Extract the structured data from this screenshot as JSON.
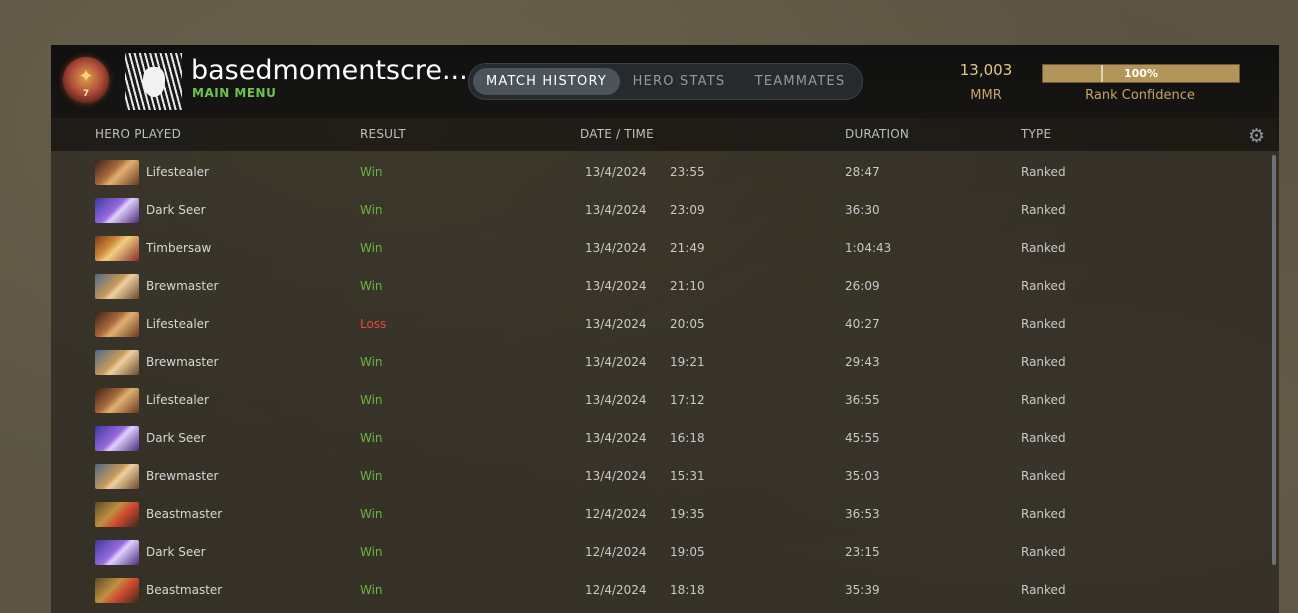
{
  "profile": {
    "username": "basedmomentscre...",
    "main_menu": "MAIN MENU",
    "rank_medal_number": "7"
  },
  "tabs": [
    {
      "label": "MATCH HISTORY",
      "active": true
    },
    {
      "label": "HERO STATS",
      "active": false
    },
    {
      "label": "TEAMMATES",
      "active": false
    }
  ],
  "stats": {
    "mmr_value": "13,003",
    "mmr_label": "MMR",
    "rank_confidence_pct": "100%",
    "rank_confidence_fraction": 1.0,
    "rank_confidence_label": "Rank Confidence"
  },
  "columns": {
    "hero": "HERO PLAYED",
    "result": "RESULT",
    "datetime": "DATE / TIME",
    "duration": "DURATION",
    "type": "TYPE"
  },
  "colors": {
    "win": "#6cb43f",
    "loss": "#e04a3a",
    "accent_green": "#6fc24d",
    "gold": "#b39559"
  },
  "matches": [
    {
      "hero": "Lifestealer",
      "hero_icon": "lifestealer-portrait",
      "result": "Win",
      "date": "13/4/2024",
      "time": "23:55",
      "duration": "28:47",
      "type": "Ranked"
    },
    {
      "hero": "Dark Seer",
      "hero_icon": "dark-seer-portrait",
      "result": "Win",
      "date": "13/4/2024",
      "time": "23:09",
      "duration": "36:30",
      "type": "Ranked"
    },
    {
      "hero": "Timbersaw",
      "hero_icon": "timbersaw-portrait",
      "result": "Win",
      "date": "13/4/2024",
      "time": "21:49",
      "duration": "1:04:43",
      "type": "Ranked"
    },
    {
      "hero": "Brewmaster",
      "hero_icon": "brewmaster-portrait",
      "result": "Win",
      "date": "13/4/2024",
      "time": "21:10",
      "duration": "26:09",
      "type": "Ranked"
    },
    {
      "hero": "Lifestealer",
      "hero_icon": "lifestealer-portrait",
      "result": "Loss",
      "date": "13/4/2024",
      "time": "20:05",
      "duration": "40:27",
      "type": "Ranked"
    },
    {
      "hero": "Brewmaster",
      "hero_icon": "brewmaster-portrait",
      "result": "Win",
      "date": "13/4/2024",
      "time": "19:21",
      "duration": "29:43",
      "type": "Ranked"
    },
    {
      "hero": "Lifestealer",
      "hero_icon": "lifestealer-portrait",
      "result": "Win",
      "date": "13/4/2024",
      "time": "17:12",
      "duration": "36:55",
      "type": "Ranked"
    },
    {
      "hero": "Dark Seer",
      "hero_icon": "dark-seer-portrait",
      "result": "Win",
      "date": "13/4/2024",
      "time": "16:18",
      "duration": "45:55",
      "type": "Ranked"
    },
    {
      "hero": "Brewmaster",
      "hero_icon": "brewmaster-portrait",
      "result": "Win",
      "date": "13/4/2024",
      "time": "15:31",
      "duration": "35:03",
      "type": "Ranked"
    },
    {
      "hero": "Beastmaster",
      "hero_icon": "beastmaster-portrait",
      "result": "Win",
      "date": "12/4/2024",
      "time": "19:35",
      "duration": "36:53",
      "type": "Ranked"
    },
    {
      "hero": "Dark Seer",
      "hero_icon": "dark-seer-portrait",
      "result": "Win",
      "date": "12/4/2024",
      "time": "19:05",
      "duration": "23:15",
      "type": "Ranked"
    },
    {
      "hero": "Beastmaster",
      "hero_icon": "beastmaster-portrait",
      "result": "Win",
      "date": "12/4/2024",
      "time": "18:18",
      "duration": "35:39",
      "type": "Ranked"
    }
  ]
}
